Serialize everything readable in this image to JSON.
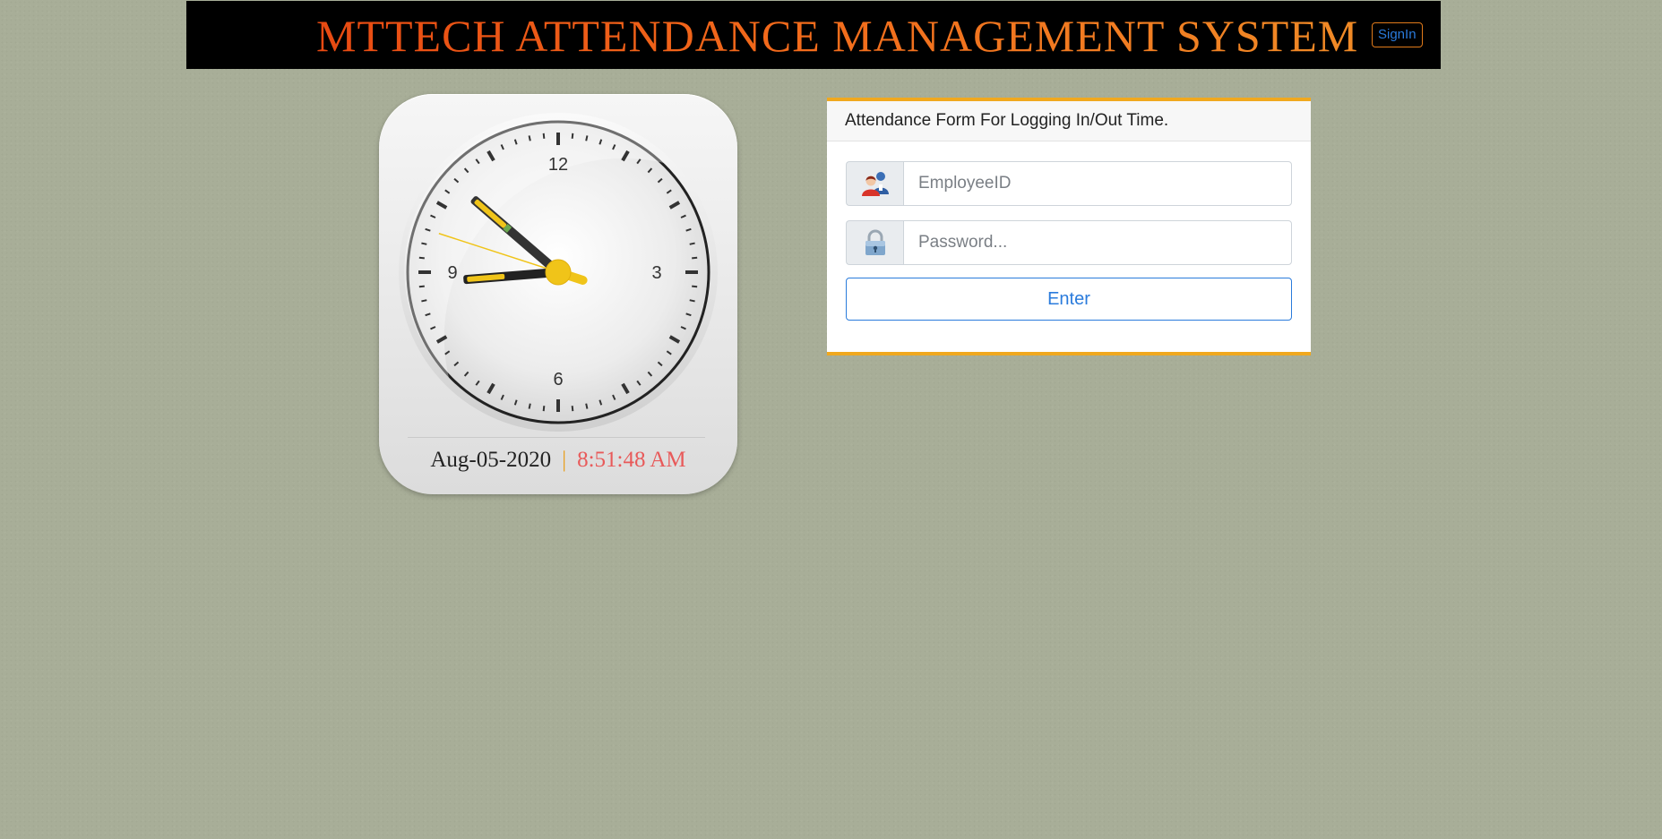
{
  "header": {
    "title": "MTTECH ATTENDANCE MANAGEMENT SYSTEM",
    "signin_label": "SignIn"
  },
  "clock": {
    "numerals": [
      "12",
      "3",
      "6",
      "9"
    ],
    "date": "Aug-05-2020",
    "separator": "|",
    "time": "8:51:48 AM"
  },
  "form": {
    "heading": "Attendance Form For Logging In/Out Time.",
    "employee_id_placeholder": "EmployeeID",
    "employee_id_value": "",
    "password_placeholder": "Password...",
    "password_value": "",
    "enter_label": "Enter"
  },
  "icons": {
    "employee": "users-icon",
    "password": "lock-icon"
  },
  "colors": {
    "page_background": "#a8ae98",
    "header_background": "#000000",
    "title_orange": "#f26a1b",
    "accent_orange": "#f0a81e",
    "link_blue": "#2a7bdc",
    "time_red": "#e85a5a"
  }
}
